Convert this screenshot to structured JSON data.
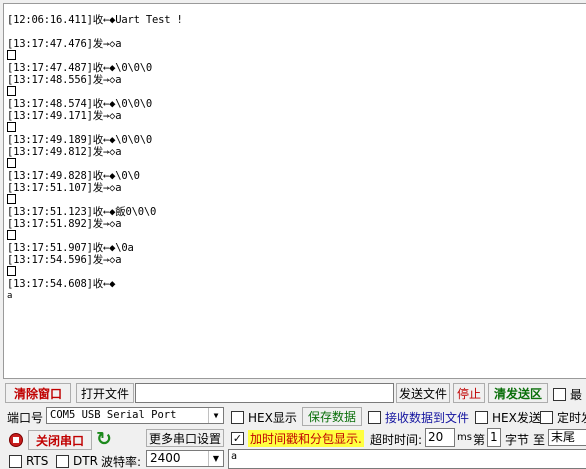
{
  "receive_lines": [
    {
      "t": "[12:06:16.411]收←◆Uart Test !",
      "k": ""
    },
    {
      "t": "",
      "k": "gap"
    },
    {
      "t": "[13:17:47.476]发→◇a",
      "k": ""
    },
    {
      "t": "",
      "k": "box"
    },
    {
      "t": "[13:17:47.487]收←◆\\0\\0\\0",
      "k": ""
    },
    {
      "t": "[13:17:48.556]发→◇a",
      "k": ""
    },
    {
      "t": "",
      "k": "box"
    },
    {
      "t": "[13:17:48.574]收←◆\\0\\0\\0",
      "k": ""
    },
    {
      "t": "[13:17:49.171]发→◇a",
      "k": ""
    },
    {
      "t": "",
      "k": "box"
    },
    {
      "t": "[13:17:49.189]收←◆\\0\\0\\0",
      "k": ""
    },
    {
      "t": "[13:17:49.812]发→◇a",
      "k": ""
    },
    {
      "t": "",
      "k": "box"
    },
    {
      "t": "[13:17:49.828]收←◆\\0\\0",
      "k": ""
    },
    {
      "t": "[13:17:51.107]发→◇a",
      "k": ""
    },
    {
      "t": "",
      "k": "box"
    },
    {
      "t": "[13:17:51.123]收←◆飯0\\0\\0",
      "k": ""
    },
    {
      "t": "[13:17:51.892]发→◇a",
      "k": ""
    },
    {
      "t": "",
      "k": "box"
    },
    {
      "t": "[13:17:51.907]收←◆\\0a",
      "k": ""
    },
    {
      "t": "[13:17:54.596]发→◇a",
      "k": ""
    },
    {
      "t": "",
      "k": "box"
    },
    {
      "t": "[13:17:54.608]收←◆",
      "k": ""
    },
    {
      "t": "a",
      "k": "small"
    }
  ],
  "toolbar": {
    "clear_window": "清除窗口",
    "open_file": "打开文件",
    "file_path": "",
    "send_file": "发送文件",
    "stop": "停止",
    "send_area": "清发送区",
    "minimize": "最"
  },
  "port": {
    "label": "端口号",
    "selected": "COM5 USB Serial Port",
    "close_port": "关闭串口",
    "more_settings": "更多串口设置",
    "rts": "RTS",
    "dtr": "DTR",
    "baud_label": "波特率:",
    "baud": "2400"
  },
  "recv_opts": {
    "hex_show": "HEX显示",
    "save_data": "保存数据",
    "recv_to_file": "接收数据到文件",
    "timestamp": "加时间戳和分包显示.",
    "timeout_label": "超时时间:",
    "timeout_value": "20",
    "timeout_unit": "ms"
  },
  "send_opts": {
    "hex_send": "HEX发送",
    "timed_send": "定时发",
    "nth_label": "第",
    "byte_value": "1",
    "byte_label": "字节",
    "to_label": "至",
    "end_value": "末尾",
    "send_text": "a"
  },
  "colors": {
    "danger": "#c00000",
    "accent_green": "#0a6f0a",
    "highlight": "#ffff40"
  }
}
